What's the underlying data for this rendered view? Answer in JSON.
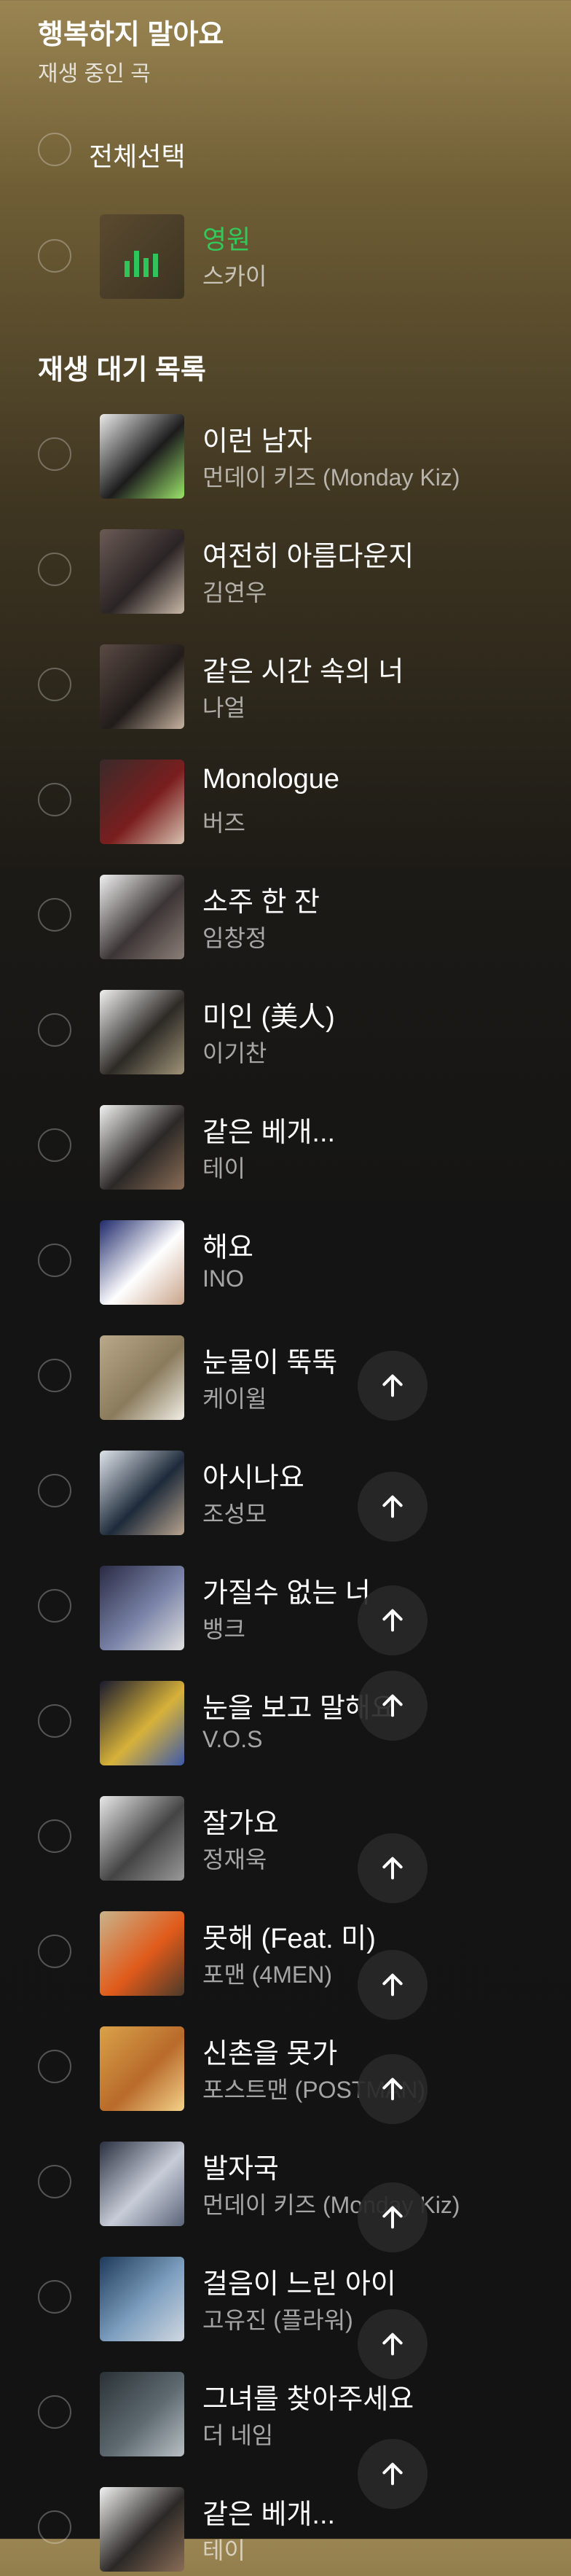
{
  "header": {
    "title": "행복하지 말아요",
    "subtitle": "재생 중인 곡"
  },
  "select_all_label": "전체선택",
  "now_playing": {
    "title": "영원",
    "artist": "스카이"
  },
  "queue_title": "재생 대기 목록",
  "queue": [
    {
      "title": "이런 남자",
      "artist": "먼데이 키즈 (Monday Kiz)",
      "thumb": [
        "#e9e9e9",
        "#1c1c1c",
        "#9be36b"
      ]
    },
    {
      "title": "여전히 아름다운지",
      "artist": "김연우",
      "thumb": [
        "#6b5b55",
        "#2a2424",
        "#c9b8a8"
      ]
    },
    {
      "title": "같은 시간 속의 너",
      "artist": "나얼",
      "thumb": [
        "#5a4a44",
        "#211c1a",
        "#c7b3a0"
      ]
    },
    {
      "title": "Monologue",
      "artist": "버즈",
      "thumb": [
        "#3a2a2a",
        "#7a1e1e",
        "#d8c2b0"
      ]
    },
    {
      "title": "소주 한 잔",
      "artist": "임창정",
      "thumb": [
        "#f0f0f0",
        "#3c3535",
        "#8c7f78"
      ]
    },
    {
      "title": "미인 (美人)",
      "artist": "이기찬",
      "thumb": [
        "#f0f0f0",
        "#2d2a26",
        "#a09478"
      ]
    },
    {
      "title": "같은 베개...",
      "artist": "테이",
      "thumb": [
        "#f2f2f2",
        "#2b2826",
        "#8a6d56"
      ]
    },
    {
      "title": "해요",
      "artist": "INO",
      "thumb": [
        "#1f2a6b",
        "#ffffff",
        "#c9a48a"
      ]
    },
    {
      "title": "눈물이 뚝뚝",
      "artist": "케이윌",
      "thumb": [
        "#b9a98a",
        "#8a7b5c",
        "#f2efe6"
      ]
    },
    {
      "title": "아시나요",
      "artist": "조성모",
      "thumb": [
        "#dfe4ea",
        "#1e2a3a",
        "#b8a48e"
      ]
    },
    {
      "title": "가질수 없는 너",
      "artist": "뱅크",
      "thumb": [
        "#2a2a44",
        "#7a84a8",
        "#e0e0e0"
      ]
    },
    {
      "title": "눈을 보고 말해요",
      "artist": "V.O.S",
      "thumb": [
        "#1a1a2e",
        "#d7b23a",
        "#3d5aa8"
      ]
    },
    {
      "title": "잘가요",
      "artist": "정재욱",
      "thumb": [
        "#e8e8e8",
        "#444444",
        "#9a9a9a"
      ]
    },
    {
      "title": "못해 (Feat. 미)",
      "artist": "포맨 (4MEN)",
      "thumb": [
        "#c9b38a",
        "#e05a1a",
        "#4a3a2a"
      ]
    },
    {
      "title": "신촌을 못가",
      "artist": "포스트맨 (POSTMAN)",
      "thumb": [
        "#d9a24a",
        "#b86a2a",
        "#f3d28a"
      ]
    },
    {
      "title": "발자국",
      "artist": "먼데이 키즈 (Monday Kiz)",
      "thumb": [
        "#2a3040",
        "#c8ccd8",
        "#5a6478"
      ]
    },
    {
      "title": "걸음이 느린 아이",
      "artist": "고유진 (플라워)",
      "thumb": [
        "#1e3a5a",
        "#7fa0c0",
        "#d0d8e0"
      ]
    },
    {
      "title": "그녀를 찾아주세요",
      "artist": "더 네임",
      "thumb": [
        "#2a3236",
        "#5e6a70",
        "#b8c0c4"
      ]
    },
    {
      "title": "같은 베개...",
      "artist": "테이",
      "thumb": [
        "#f2f2f2",
        "#2b2826",
        "#8a6d56"
      ]
    }
  ],
  "colors": {
    "playing_accent": "#34c759",
    "button_bg": "#282828"
  },
  "icons": {
    "up_button": "arrow-up-icon",
    "now_playing": "equalizer-icon"
  }
}
